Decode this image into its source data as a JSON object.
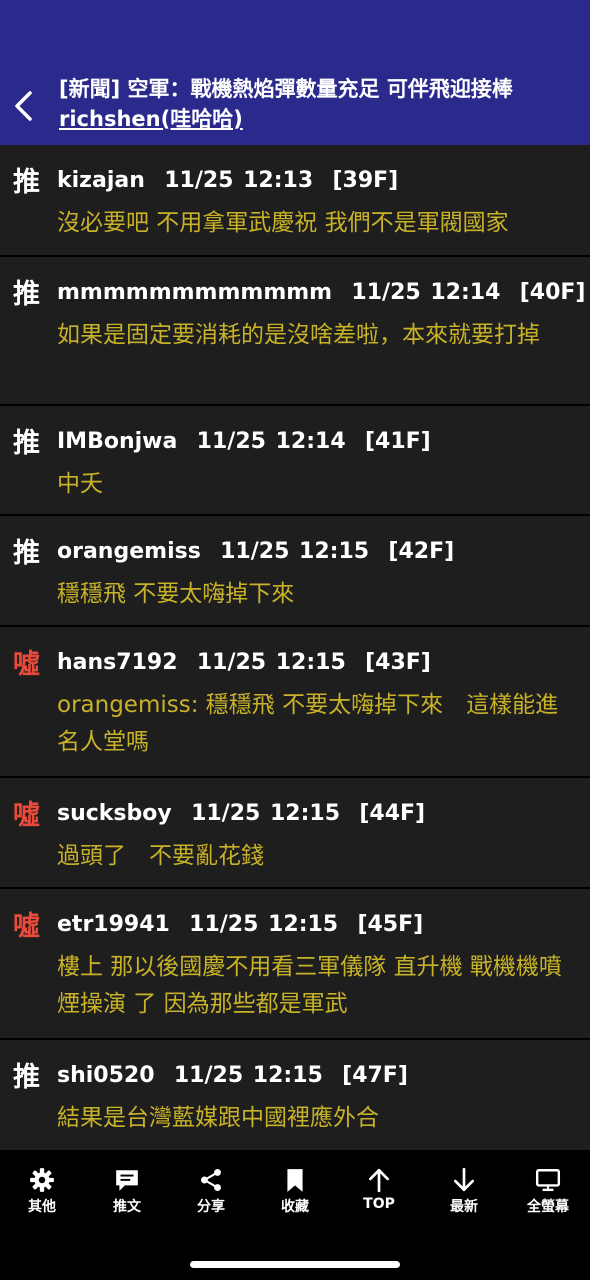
{
  "header": {
    "title": "[新聞] 空軍：戰機熱焰彈數量充足 可伴飛迎接棒",
    "author": "richshen(哇哈哈)",
    "accent_color": "#2b2a8c"
  },
  "comments": [
    {
      "tag": "推",
      "type": "push",
      "user": "kizajan",
      "time": "11/25 12:13",
      "floor": "[39F]",
      "text": "沒必要吧 不用拿軍武慶祝 我們不是軍閥國家"
    },
    {
      "tag": "推",
      "type": "push",
      "user": "mmmmmmmmmmmm",
      "time": "11/25 12:14",
      "floor": "[40F]",
      "text": "如果是固定要消耗的是沒啥差啦，本來就要打掉"
    },
    {
      "tag": "推",
      "type": "push",
      "user": "IMBonjwa",
      "time": "11/25 12:14",
      "floor": "[41F]",
      "text": "中夭"
    },
    {
      "tag": "推",
      "type": "push",
      "user": "orangemiss",
      "time": "11/25 12:15",
      "floor": "[42F]",
      "text": "穩穩飛 不要太嗨掉下來"
    },
    {
      "tag": "噓",
      "type": "boo",
      "user": "hans7192",
      "time": "11/25 12:15",
      "floor": "[43F]",
      "text": "orangemiss: 穩穩飛 不要太嗨掉下來　這樣能進名人堂嗎"
    },
    {
      "tag": "噓",
      "type": "boo",
      "user": "sucksboy",
      "time": "11/25 12:15",
      "floor": "[44F]",
      "text": "過頭了　不要亂花錢"
    },
    {
      "tag": "噓",
      "type": "boo",
      "user": "etr19941",
      "time": "11/25 12:15",
      "floor": "[45F]",
      "text": "樓上 那以後國慶不用看三軍儀隊 直升機 戰機機噴煙操演 了 因為那些都是軍武"
    },
    {
      "tag": "推",
      "type": "push",
      "user": "shi0520",
      "time": "11/25 12:15",
      "floor": "[47F]",
      "text": "結果是台灣藍媒跟中國裡應外合"
    }
  ],
  "toolbar": {
    "items": [
      {
        "label": "其他",
        "icon": "gear-icon"
      },
      {
        "label": "推文",
        "icon": "comment-icon"
      },
      {
        "label": "分享",
        "icon": "share-icon"
      },
      {
        "label": "收藏",
        "icon": "bookmark-icon"
      },
      {
        "label": "TOP",
        "icon": "arrow-up-icon"
      },
      {
        "label": "最新",
        "icon": "arrow-down-icon"
      },
      {
        "label": "全螢幕",
        "icon": "monitor-icon"
      }
    ]
  },
  "colors": {
    "push_tag": "#ffffff",
    "boo_tag": "#e84b3c",
    "comment_text": "#c8b228",
    "background": "#1e1e1e"
  }
}
